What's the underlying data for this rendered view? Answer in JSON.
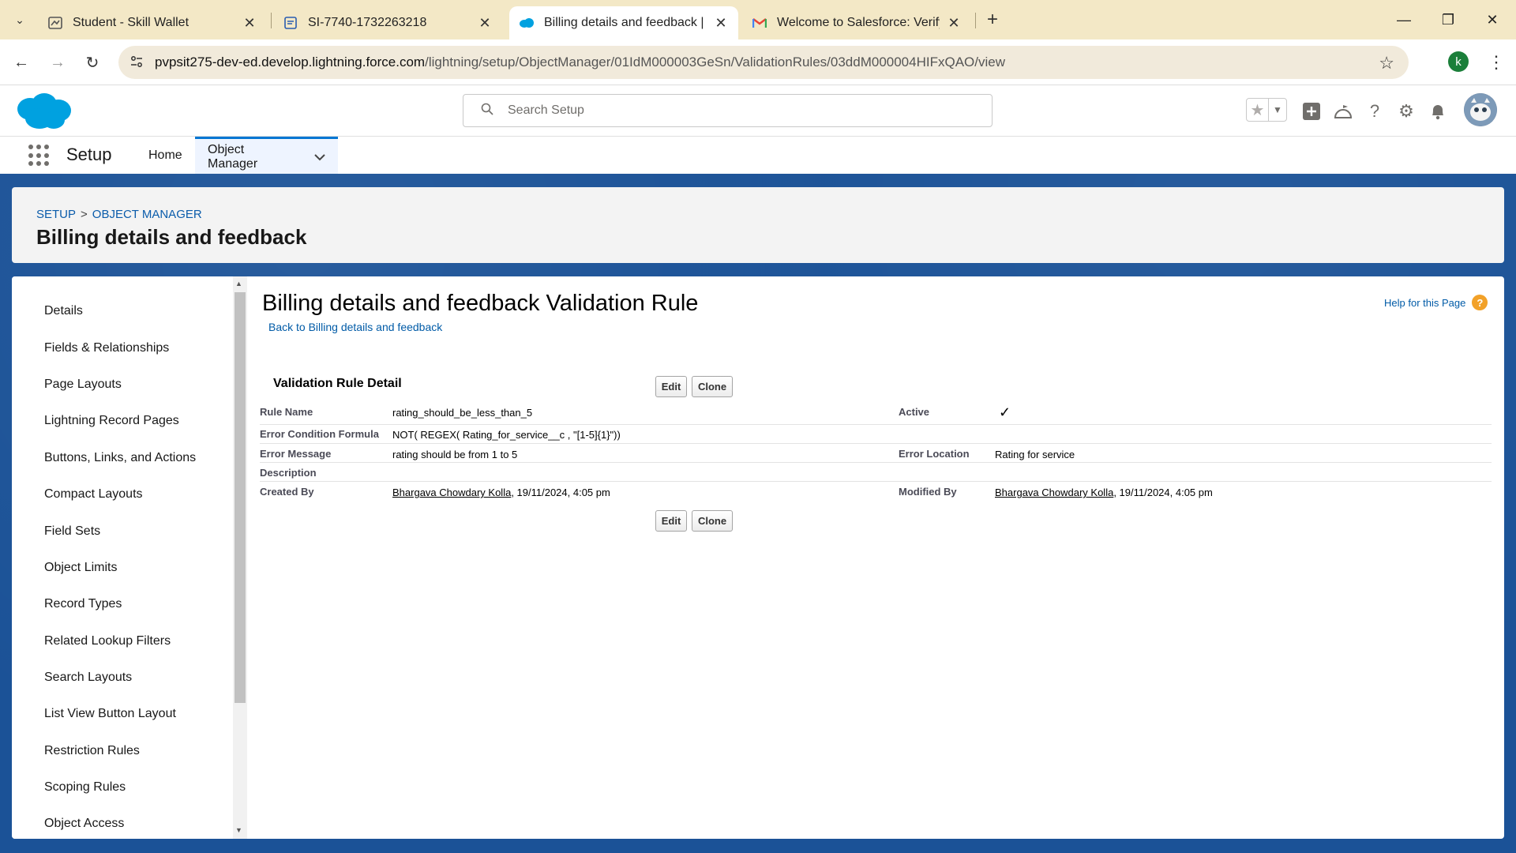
{
  "browser": {
    "tabs": [
      {
        "title": "Student - Skill Wallet",
        "icon": "skill-wallet-icon"
      },
      {
        "title": "SI-7740-1732263218",
        "icon": "doc-icon"
      },
      {
        "title": "Billing details and feedback | Sa",
        "icon": "salesforce-cloud-icon"
      },
      {
        "title": "Welcome to Salesforce: Verify y",
        "icon": "gmail-icon"
      }
    ],
    "url_host": "pvpsit275-dev-ed.develop.lightning.force.com",
    "url_path": "/lightning/setup/ObjectManager/01IdM000003GeSn/ValidationRules/03ddM000004HIFxQAO/view",
    "profile_initial": "k"
  },
  "header": {
    "search_placeholder": "Search Setup"
  },
  "nav": {
    "app_name": "Setup",
    "items": [
      "Home",
      "Object Manager"
    ]
  },
  "page_header": {
    "breadcrumb": [
      "SETUP",
      "OBJECT MANAGER"
    ],
    "breadcrumb_sep": ">",
    "title": "Billing details and feedback"
  },
  "sidebar": {
    "items": [
      "Details",
      "Fields & Relationships",
      "Page Layouts",
      "Lightning Record Pages",
      "Buttons, Links, and Actions",
      "Compact Layouts",
      "Field Sets",
      "Object Limits",
      "Record Types",
      "Related Lookup Filters",
      "Search Layouts",
      "List View Button Layout",
      "Restriction Rules",
      "Scoping Rules",
      "Object Access"
    ]
  },
  "content": {
    "title": "Billing details and feedback Validation Rule",
    "back_link": "Back to Billing details and feedback",
    "help_link": "Help for this Page",
    "section_title": "Validation Rule Detail",
    "edit_label": "Edit",
    "clone_label": "Clone",
    "fields": {
      "rule_name_label": "Rule Name",
      "rule_name_value": "rating_should_be_less_than_5",
      "active_label": "Active",
      "active_value": "✓",
      "formula_label": "Error Condition Formula",
      "formula_value": "NOT( REGEX( Rating_for_service__c , \"[1-5]{1}\"))",
      "error_message_label": "Error Message",
      "error_message_value": "rating should be from 1 to 5",
      "error_location_label": "Error Location",
      "error_location_value": "Rating for service",
      "description_label": "Description",
      "created_by_label": "Created By",
      "created_by_user": "Bhargava Chowdary Kolla",
      "created_by_date": ", 19/11/2024, 4:05 pm",
      "modified_by_label": "Modified By",
      "modified_by_user": "Bhargava Chowdary Kolla",
      "modified_by_date": ", 19/11/2024, 4:05 pm"
    }
  },
  "colors": {
    "brand_blue": "#1b5297",
    "link_blue": "#015ba7",
    "salesforce_cloud": "#00a1e0"
  }
}
